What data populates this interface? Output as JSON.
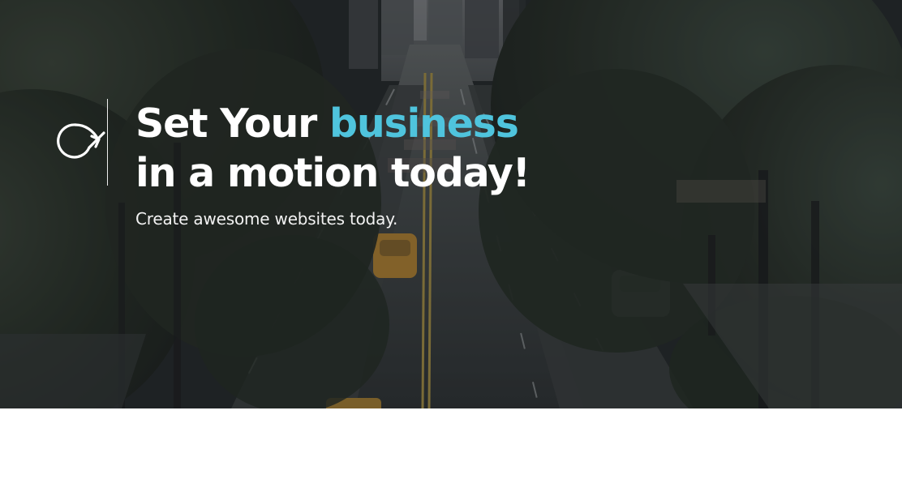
{
  "hero": {
    "headline": {
      "line1_prefix": "Set Your ",
      "line1_accent": "business",
      "line2": "in a motion today!"
    },
    "subheadline": "Create awesome websites today.",
    "logo_icon": "motion-loop-icon",
    "colors": {
      "accent": "#4fc4dd",
      "headline_text": "#ffffff",
      "overlay": "#23272a"
    }
  }
}
